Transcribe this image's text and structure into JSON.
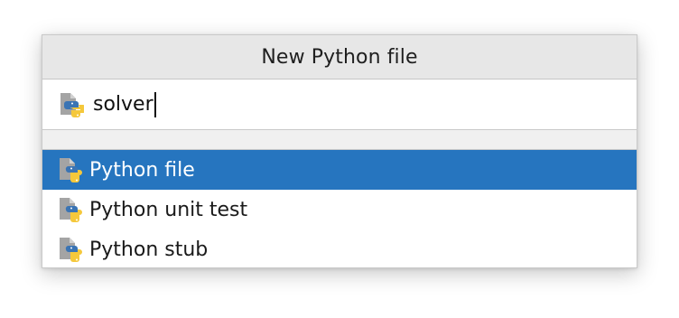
{
  "dialog": {
    "title": "New Python file",
    "input": {
      "value": "solver",
      "icon": "python-file-icon"
    },
    "options": [
      {
        "label": "Python file",
        "icon": "python-file-icon",
        "selected": true
      },
      {
        "label": "Python unit test",
        "icon": "python-file-icon",
        "selected": false
      },
      {
        "label": "Python stub",
        "icon": "python-file-icon",
        "selected": false
      }
    ]
  },
  "colors": {
    "selection": "#2675bf",
    "title_bar": "#e7e7e7",
    "python_blue": "#3a74b4",
    "python_yellow": "#f5c83b",
    "file_gray": "#a4a4a4"
  }
}
